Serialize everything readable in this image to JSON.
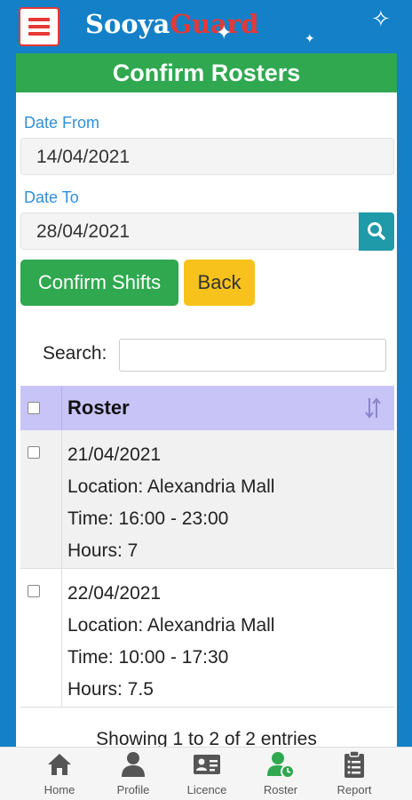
{
  "app": {
    "brand_part1": "Sooya",
    "brand_part2": "Guard"
  },
  "page": {
    "title": "Confirm Rosters"
  },
  "form": {
    "date_from_label": "Date From",
    "date_from_value": "14/04/2021",
    "date_to_label": "Date To",
    "date_to_value": "28/04/2021"
  },
  "buttons": {
    "confirm": "Confirm Shifts",
    "back": "Back"
  },
  "search": {
    "label": "Search:",
    "value": ""
  },
  "table": {
    "header": "Roster",
    "rows": [
      {
        "date": "21/04/2021",
        "location": "Location: Alexandria Mall",
        "time": "Time: 16:00 - 23:00",
        "hours": "Hours: 7"
      },
      {
        "date": "22/04/2021",
        "location": "Location: Alexandria Mall",
        "time": "Time: 10:00 - 17:30",
        "hours": "Hours: 7.5"
      }
    ],
    "info": "Showing 1 to 2 of 2 entries"
  },
  "nav": {
    "items": [
      {
        "label": "Home",
        "icon": "home-icon"
      },
      {
        "label": "Profile",
        "icon": "profile-icon"
      },
      {
        "label": "Licence",
        "icon": "licence-icon"
      },
      {
        "label": "Roster",
        "icon": "roster-icon",
        "active": true
      },
      {
        "label": "Report",
        "icon": "report-icon"
      }
    ]
  },
  "colors": {
    "topbar": "#1380c8",
    "title_bar": "#2fa84f",
    "search_button": "#1f9aa8",
    "back_button": "#f7c21b",
    "table_header": "#c8c4f7",
    "active_nav": "#2fa84f"
  }
}
